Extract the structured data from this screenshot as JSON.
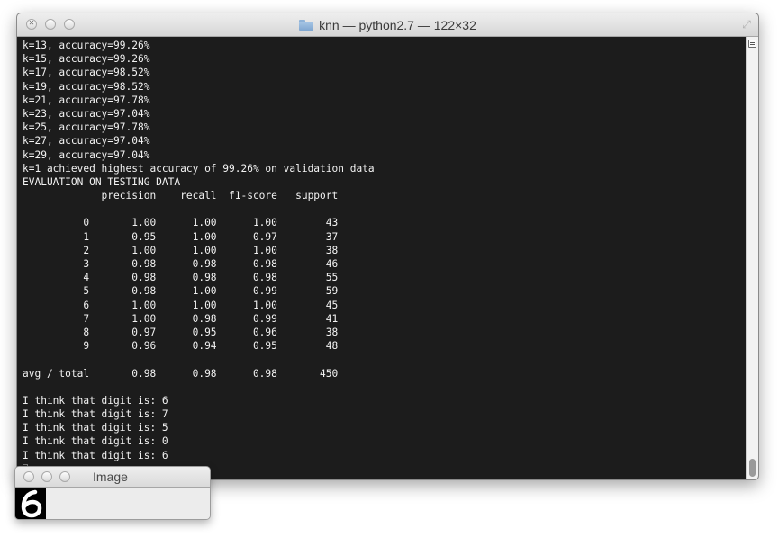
{
  "terminal": {
    "title": "knn — python2.7 — 122×32",
    "lines": [
      "k=13, accuracy=99.26%",
      "k=15, accuracy=99.26%",
      "k=17, accuracy=98.52%",
      "k=19, accuracy=98.52%",
      "k=21, accuracy=97.78%",
      "k=23, accuracy=97.04%",
      "k=25, accuracy=97.78%",
      "k=27, accuracy=97.04%",
      "k=29, accuracy=97.04%",
      "k=1 achieved highest accuracy of 99.26% on validation data",
      "EVALUATION ON TESTING DATA",
      "             precision    recall  f1-score   support",
      "",
      "          0       1.00      1.00      1.00        43",
      "          1       0.95      1.00      0.97        37",
      "          2       1.00      1.00      1.00        38",
      "          3       0.98      0.98      0.98        46",
      "          4       0.98      0.98      0.98        55",
      "          5       0.98      1.00      0.99        59",
      "          6       1.00      1.00      1.00        45",
      "          7       1.00      0.98      0.99        41",
      "          8       0.97      0.95      0.96        38",
      "          9       0.96      0.94      0.95        48",
      "",
      "avg / total       0.98      0.98      0.98       450",
      "",
      "I think that digit is: 6",
      "I think that digit is: 7",
      "I think that digit is: 5",
      "I think that digit is: 0",
      "I think that digit is: 6"
    ]
  },
  "image_window": {
    "title": "Image"
  },
  "icons": {
    "folder": "folder-icon",
    "resize": "fullscreen-icon",
    "scroll_menu": "scroll-menu-icon"
  }
}
